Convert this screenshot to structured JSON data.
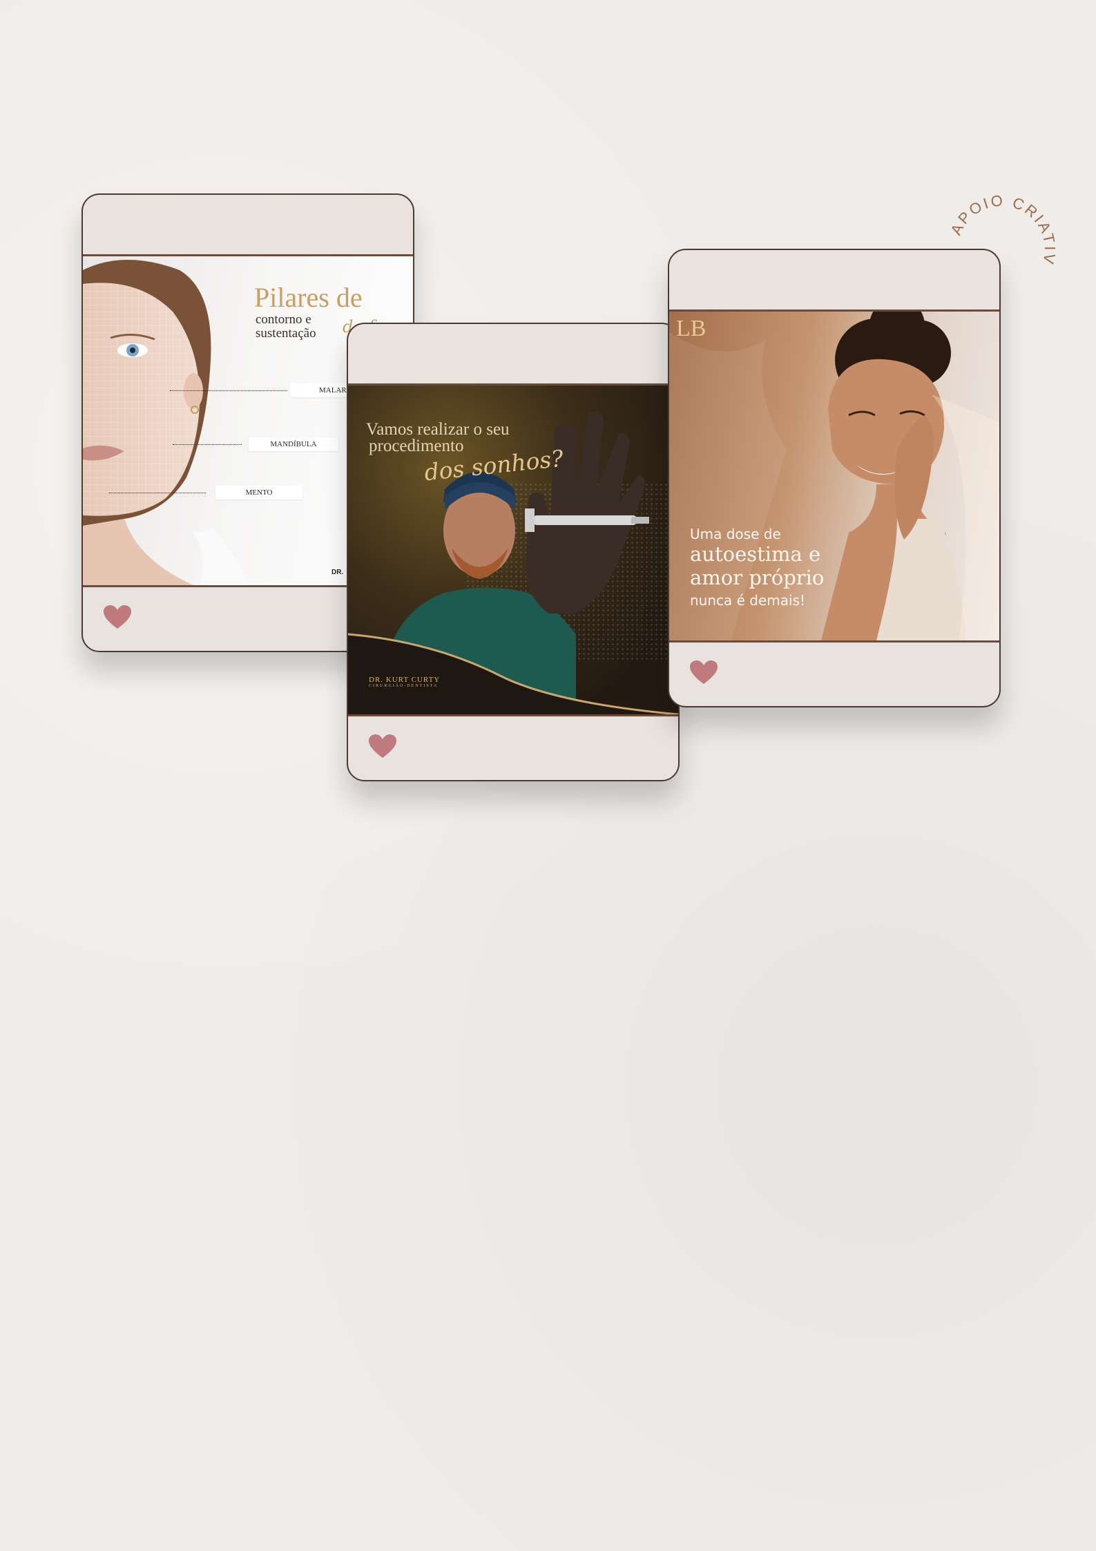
{
  "badge": {
    "text": "APOIO CRIATIVO"
  },
  "cards": [
    {
      "title": "Pilares de",
      "subtitle_line1": "contorno e",
      "subtitle_line2": "sustentação",
      "script": "da face",
      "labels": [
        "MALAR",
        "MANDÍBULA",
        "MENTO"
      ],
      "signature": "DR."
    },
    {
      "line1": "Vamos realizar o seu",
      "line2": "procedimento",
      "script": "dos sonhos?",
      "logo_name": "DR. KURT CURTY",
      "logo_role": "CIRURGIÃO-DENTISTA"
    },
    {
      "monogram": "LB",
      "line1": "Uma dose de",
      "line2": "autoestima e",
      "line3": "amor próprio",
      "line4": "nunca é demais!"
    }
  ],
  "colors": {
    "heart": "#c07a7d",
    "frame": "#4b3a30",
    "gold": "#c99d63"
  },
  "icons": {
    "like": "heart-icon"
  }
}
